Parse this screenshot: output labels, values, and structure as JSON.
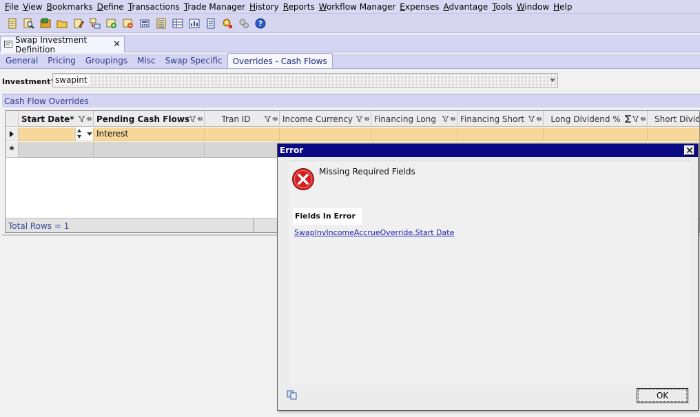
{
  "menubar": {
    "items": [
      "File",
      "View",
      "Bookmarks",
      "Define",
      "Transactions",
      "Trade Manager",
      "History",
      "Reports",
      "Workflow Manager",
      "Expenses",
      "Advantage",
      "Tools",
      "Window",
      "Help"
    ]
  },
  "toolbar": {
    "icons": [
      "document-icon",
      "search-icon",
      "report-icon",
      "folder-icon",
      "edit-icon",
      "transfer-icon",
      "add-icon",
      "remove-icon",
      "calculator-icon",
      "list-icon",
      "table-icon",
      "table-chart-icon",
      "notepad-icon",
      "settings-icon",
      "tools-icon",
      "help-icon"
    ]
  },
  "document_tab": {
    "title": "Swap Investment Definition",
    "close": "✕"
  },
  "tabs": {
    "items": [
      {
        "label": "General"
      },
      {
        "label": "Pricing"
      },
      {
        "label": "Groupings"
      },
      {
        "label": "Misc"
      },
      {
        "label": "Swap Specific"
      },
      {
        "label": "Overrides - Cash Flows",
        "active": true
      }
    ]
  },
  "investment": {
    "label": "Investment",
    "required_mark": "*",
    "value": "swapint"
  },
  "cash_flow_overrides": {
    "section_title": "Cash Flow Overrides",
    "columns": [
      "Start Date*",
      "Pending Cash Flows*",
      "Tran ID",
      "Income Currency",
      "Financing Long",
      "Financing Short",
      "Long Dividend %",
      "Short Dividend"
    ],
    "rows": [
      {
        "start_date": "",
        "pending_cash_flows": "Interest",
        "tran_id": "",
        "income_currency": "",
        "financing_long": "",
        "financing_short": "",
        "long_dividend": "",
        "short_dividend": ""
      }
    ],
    "new_row_marker": "*",
    "footer": "Total Rows = 1"
  },
  "error_dialog": {
    "title": "Error",
    "message": "Missing Required Fields",
    "fields_header": "Fields In Error",
    "fields": [
      "SwapInvIncomeAccrueOverride.Start Date"
    ],
    "ok_label": "OK"
  },
  "colors": {
    "accent": "#0a0a86",
    "selected_row": "#f8d89a",
    "error_icon": "#d42020"
  }
}
